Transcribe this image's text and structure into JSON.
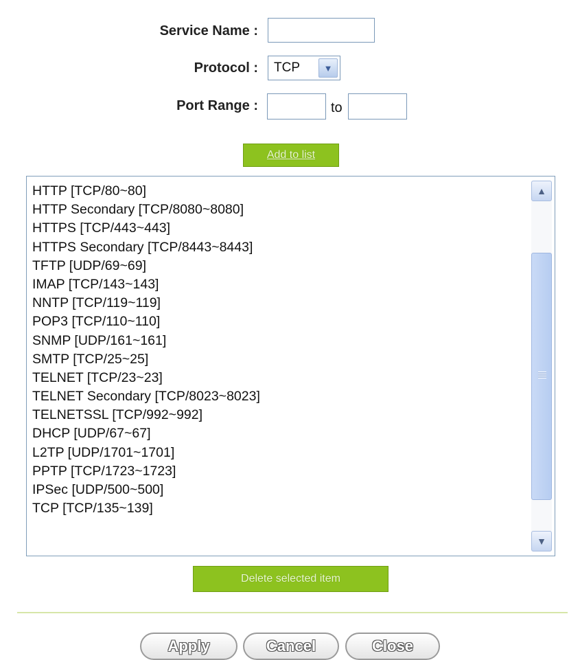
{
  "form": {
    "service_name_label": "Service Name :",
    "service_name_value": "",
    "protocol_label": "Protocol :",
    "protocol_value": "TCP",
    "port_range_label": "Port Range :",
    "port_from_value": "",
    "port_to_value": "",
    "to_label": "to"
  },
  "buttons": {
    "add_to_list": "Add to list",
    "delete_selected": "Delete selected item",
    "apply": "Apply",
    "cancel": "Cancel",
    "close": "Close"
  },
  "service_list": {
    "items": [
      "HTTP [TCP/80~80]",
      "HTTP Secondary [TCP/8080~8080]",
      "HTTPS [TCP/443~443]",
      "HTTPS Secondary [TCP/8443~8443]",
      "TFTP [UDP/69~69]",
      "IMAP [TCP/143~143]",
      "NNTP [TCP/119~119]",
      "POP3 [TCP/110~110]",
      "SNMP [UDP/161~161]",
      "SMTP [TCP/25~25]",
      "TELNET [TCP/23~23]",
      "TELNET Secondary [TCP/8023~8023]",
      "TELNETSSL [TCP/992~992]",
      "DHCP [UDP/67~67]",
      "L2TP [UDP/1701~1701]",
      "PPTP [TCP/1723~1723]",
      "IPSec [UDP/500~500]",
      "TCP [TCP/135~139]"
    ]
  },
  "colors": {
    "green_button": "#8dc21f",
    "input_border": "#7a98b8",
    "divider": "#d7e6a8"
  }
}
